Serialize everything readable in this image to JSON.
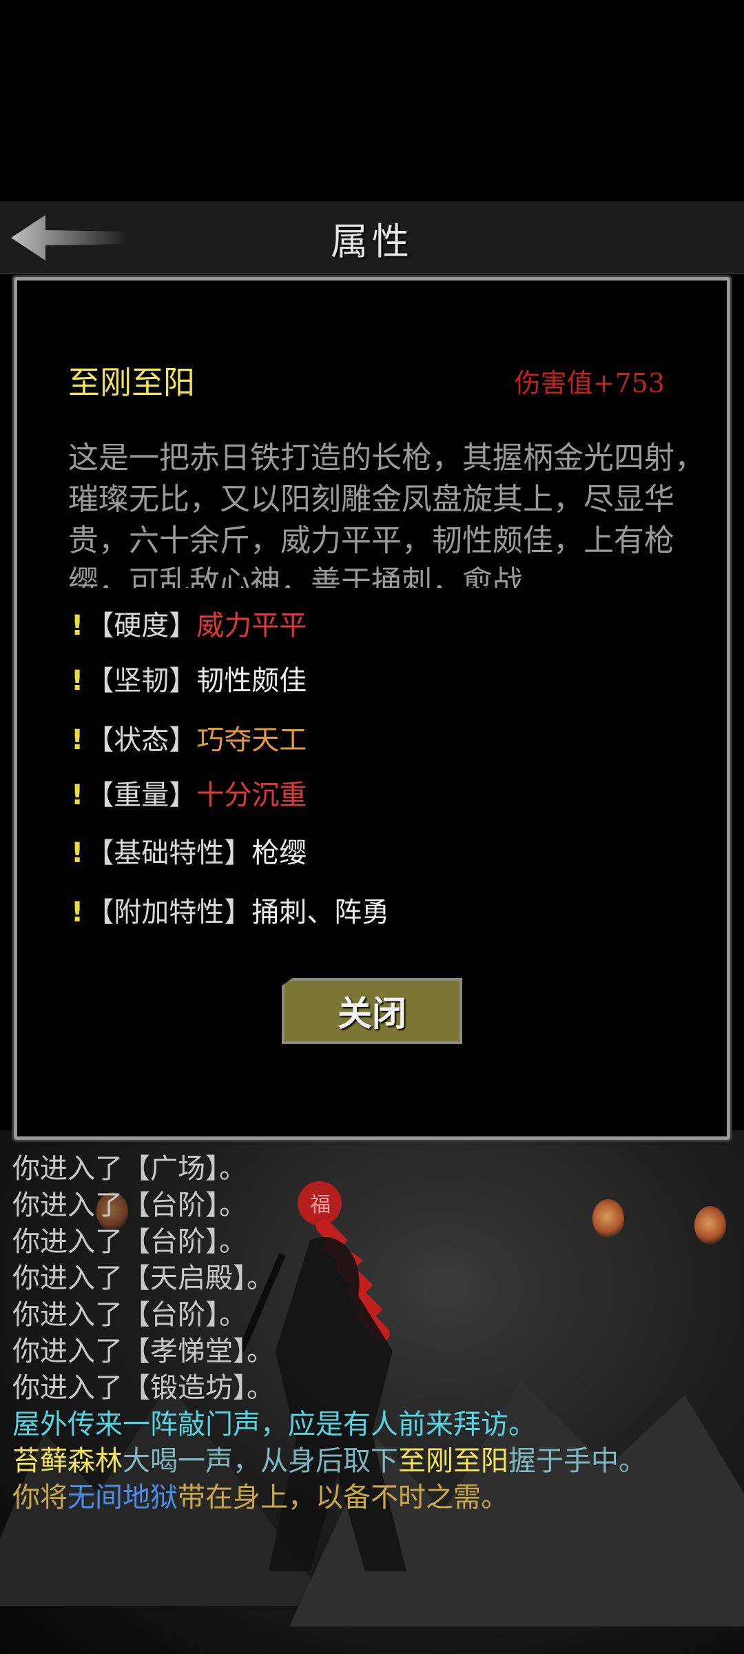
{
  "header": {
    "title": "属性",
    "back_label": "back"
  },
  "item": {
    "name": "至刚至阳",
    "damage": "伤害值+753",
    "description": "这是一把赤日铁打造的长枪，其握柄金光四射，璀璨无比，又以阳刻雕金凤盘旋其上，尽显华贵，六十余斤，威力平平，韧性颇佳，上有枪缨，可乱敌心神，善于捅刺，愈战"
  },
  "attributes": [
    {
      "key": "【硬度】",
      "value": "威力平平",
      "color": "#e03838"
    },
    {
      "key": "【坚韧】",
      "value": "韧性颇佳",
      "color": "#ececec"
    },
    {
      "key": "【状态】",
      "value": "巧夺天工",
      "color": "#e39a3b"
    },
    {
      "key": "【重量】",
      "value": "十分沉重",
      "color": "#e03838"
    },
    {
      "key": "【基础特性】",
      "value": "枪缨",
      "color": "#ececec"
    },
    {
      "key": "【附加特性】",
      "value": "捅刺、阵勇",
      "color": "#ececec"
    }
  ],
  "attribute_marker": "!",
  "close_label": "关闭",
  "log": {
    "lines": [
      "你进入了【广场】。",
      "你进入了【台阶】。",
      "你进入了【台阶】。",
      "你进入了【天启殿】。",
      "你进入了【台阶】。",
      "你进入了【孝悌堂】。",
      "你进入了【锻造坊】。",
      "屋外传来一阵敲门声，应是有人前来拜访。"
    ],
    "line9": {
      "npc": "苔藓森林",
      "part1": "大喝一声，从身后取下",
      "weapon": "至刚至阳",
      "part2": "握于手中。"
    },
    "line10": {
      "part1": "你将",
      "item": "无间地狱",
      "part2": "带在身上，以备不时之需。"
    }
  },
  "colors": {
    "name_yellow": "#f1e45a",
    "damage_red": "#c32222",
    "system_cyan": "#57d4e2",
    "item_blue": "#4a8ee8",
    "button_olive": "#7b7634"
  }
}
